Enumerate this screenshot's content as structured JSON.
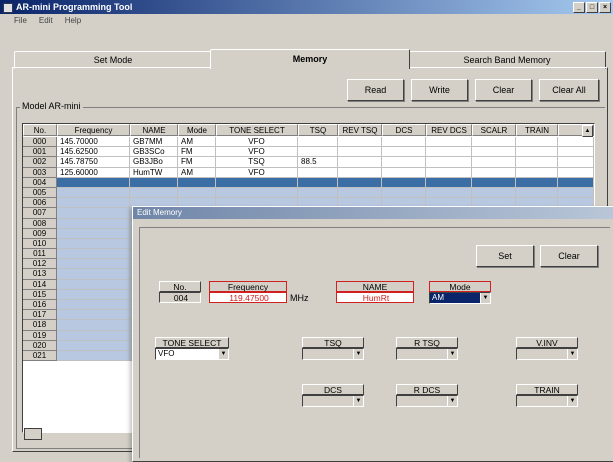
{
  "window": {
    "title": "AR-mini Programming Tool"
  },
  "menu": [
    "File",
    "Edit",
    "Help"
  ],
  "tabs": [
    "Set Mode",
    "Memory",
    "Search Band Memory"
  ],
  "active_tab": "Memory",
  "toolbar": {
    "read": "Read",
    "write": "Write",
    "clear": "Clear",
    "clear_all": "Clear All"
  },
  "group_label": "Model AR-mini",
  "columns": [
    "No.",
    "Frequency",
    "NAME",
    "Mode",
    "TONE SELECT",
    "TSQ",
    "REV TSQ",
    "DCS",
    "REV DCS",
    "SCALR",
    "TRAIN"
  ],
  "rows": [
    {
      "no": "000",
      "freq": "145.70000",
      "name": "GB7MM",
      "mode": "AM",
      "tone": "VFO",
      "tsq": ""
    },
    {
      "no": "001",
      "freq": "145.62500",
      "name": "GB3SCo",
      "mode": "FM",
      "tone": "VFO",
      "tsq": ""
    },
    {
      "no": "002",
      "freq": "145.78750",
      "name": "GB3JBo",
      "mode": "FM",
      "tone": "TSQ",
      "tsq": "88.5"
    },
    {
      "no": "003",
      "freq": "125.60000",
      "name": "HumTW",
      "mode": "AM",
      "tone": "VFO",
      "tsq": ""
    },
    {
      "no": "004"
    },
    {
      "no": "005"
    },
    {
      "no": "006"
    },
    {
      "no": "007"
    },
    {
      "no": "008"
    },
    {
      "no": "009"
    },
    {
      "no": "010"
    },
    {
      "no": "011"
    },
    {
      "no": "012"
    },
    {
      "no": "013"
    },
    {
      "no": "014"
    },
    {
      "no": "015"
    },
    {
      "no": "016"
    },
    {
      "no": "017"
    },
    {
      "no": "018"
    },
    {
      "no": "019"
    },
    {
      "no": "020"
    },
    {
      "no": "021"
    }
  ],
  "selected_row": "004",
  "dialog": {
    "title": "Edit Memory",
    "set": "Set",
    "clear": "Clear",
    "no_label": "No.",
    "no_value": "004",
    "freq_label": "Frequency",
    "freq_value": "119.47500",
    "freq_unit": "MHz",
    "name_label": "NAME",
    "name_value": "HumRt",
    "mode_label": "Mode",
    "mode_value": "AM",
    "tone_label": "TONE SELECT",
    "tone_value": "VFO",
    "tsq_label": "TSQ",
    "rtsq_label": "R TSQ",
    "vinv_label": "V.INV",
    "dcs_label": "DCS",
    "rdcs_label": "R DCS",
    "train_label": "TRAIN"
  },
  "colors": {
    "selection": "#3a6ea5",
    "highlight_text": "#d02020",
    "window_bg": "#d4d0c8"
  }
}
